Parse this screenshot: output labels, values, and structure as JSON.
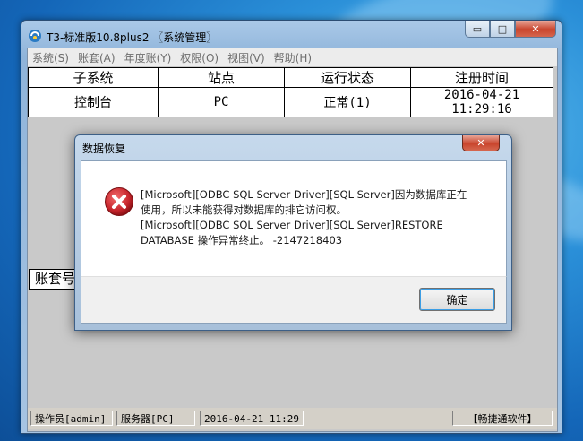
{
  "window": {
    "title": "T3-标准版10.8plus2 〖系统管理〗",
    "controls": {
      "minimize": "▭",
      "maximize": "□",
      "close": "✕"
    }
  },
  "menu": [
    "系统(S)",
    "账套(A)",
    "年度账(Y)",
    "权限(O)",
    "视图(V)",
    "帮助(H)"
  ],
  "table": {
    "headers": [
      "子系统",
      "站点",
      "运行状态",
      "注册时间"
    ],
    "rows": [
      [
        "控制台",
        "PC",
        "正常(1)",
        "2016-04-21 11:29:16"
      ]
    ]
  },
  "account_section_label": "账套号",
  "statusbar": {
    "operator": "操作员[admin]",
    "server": "服务器[PC]",
    "datetime": "2016-04-21 11:29",
    "vendor": "【畅捷通软件】"
  },
  "dialog": {
    "title": "数据恢复",
    "close": "✕",
    "message_lines": [
      "[Microsoft][ODBC SQL Server Driver][SQL Server]因为数据库正在",
      "使用，所以未能获得对数据库的排它访问权。",
      "[Microsoft][ODBC SQL Server Driver][SQL Server]RESTORE",
      "DATABASE 操作异常终止。 -2147218403"
    ],
    "ok_label": "确定",
    "icon": "error-icon"
  },
  "colors": {
    "error_red": "#c8262d",
    "close_red": "#c9452d",
    "desktop_blue": "#2a8fd8"
  }
}
